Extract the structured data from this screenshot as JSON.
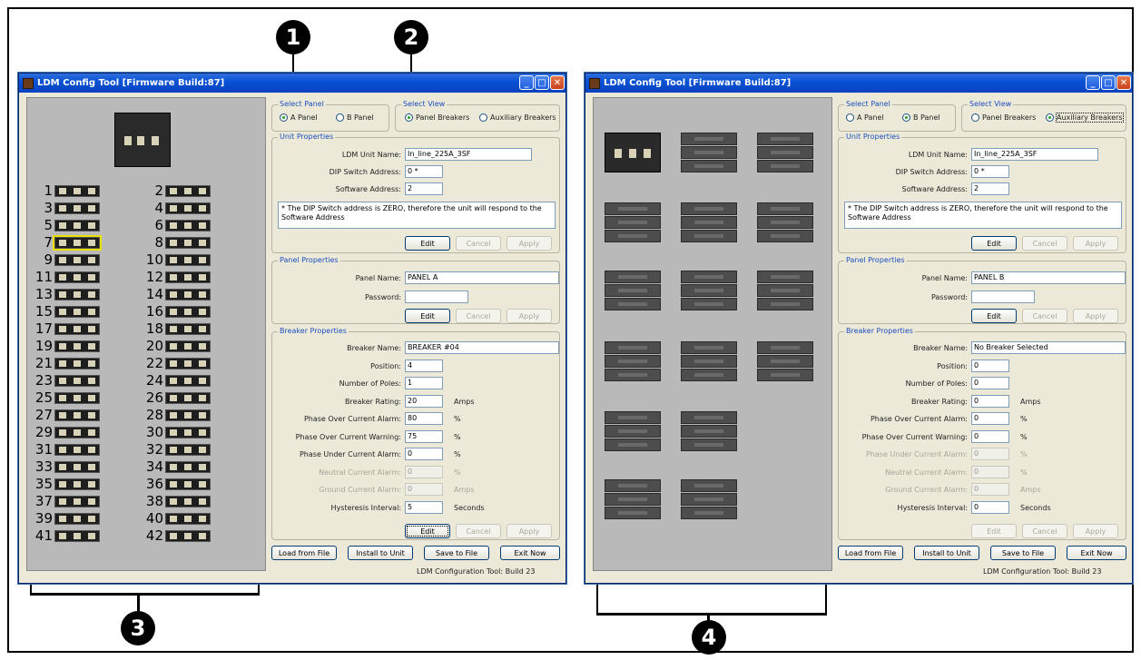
{
  "callouts": [
    "1",
    "2",
    "3",
    "4"
  ],
  "left": {
    "title": "LDM Config Tool [Firmware Build:87]",
    "select_panel": {
      "label": "Select Panel",
      "a": "A Panel",
      "b": "B Panel",
      "selected": "A Panel"
    },
    "select_view": {
      "label": "Select View",
      "panel": "Panel Breakers",
      "aux": "Auxiliary Breakers",
      "selected": "Panel Breakers"
    },
    "unit": {
      "label": "Unit Properties",
      "name_label": "LDM Unit Name:",
      "name": "In_line_225A_3SF",
      "dip_label": "DIP Switch Address:",
      "dip": "0 *",
      "sw_label": "Software Address:",
      "sw": "2",
      "note": "* The DIP Switch address is ZERO, therefore the unit will respond to the Software Address",
      "edit": "Edit",
      "cancel": "Cancel",
      "apply": "Apply"
    },
    "panel": {
      "label": "Panel Properties",
      "name_label": "Panel Name:",
      "name": "PANEL A",
      "pw_label": "Password:",
      "pw": "",
      "edit": "Edit",
      "cancel": "Cancel",
      "apply": "Apply"
    },
    "breaker": {
      "label": "Breaker Properties",
      "name_label": "Breaker Name:",
      "name": "BREAKER #04",
      "pos_label": "Position:",
      "pos": "4",
      "poles_label": "Number of Poles:",
      "poles": "1",
      "rating_label": "Breaker Rating:",
      "rating": "20",
      "rating_unit": "Amps",
      "poca_label": "Phase Over Current Alarm:",
      "poca": "80",
      "poca_unit": "%",
      "pocw_label": "Phase Over Current Warning:",
      "pocw": "75",
      "pocw_unit": "%",
      "puca_label": "Phase Under Current Alarm:",
      "puca": "0",
      "puca_unit": "%",
      "nca_label": "Neutral Current Alarm:",
      "nca": "0",
      "nca_unit": "%",
      "gca_label": "Ground Current Alarm:",
      "gca": "0",
      "gca_unit": "Amps",
      "hyst_label": "Hysteresis Interval:",
      "hyst": "5",
      "hyst_unit": "Seconds",
      "edit": "Edit",
      "cancel": "Cancel",
      "apply": "Apply"
    },
    "bottom": {
      "load": "Load from File",
      "install": "Install to Unit",
      "save": "Save to File",
      "exit": "Exit Now"
    },
    "status": "LDM Configuration Tool: Build 23",
    "breaker_numbers_left": [
      "1",
      "3",
      "5",
      "7",
      "9",
      "11",
      "13",
      "15",
      "17",
      "19",
      "21",
      "23",
      "25",
      "27",
      "29",
      "31",
      "33",
      "35",
      "37",
      "39",
      "41"
    ],
    "breaker_numbers_right": [
      "2",
      "4",
      "6",
      "8",
      "10",
      "12",
      "14",
      "16",
      "18",
      "20",
      "22",
      "24",
      "26",
      "28",
      "30",
      "32",
      "34",
      "36",
      "38",
      "40",
      "42"
    ],
    "selected_breaker": "7"
  },
  "right": {
    "title": "LDM Config Tool [Firmware Build:87]",
    "select_panel": {
      "label": "Select Panel",
      "a": "A Panel",
      "b": "B Panel",
      "selected": "B Panel"
    },
    "select_view": {
      "label": "Select View",
      "panel": "Panel Breakers",
      "aux": "Auxiliary Breakers",
      "selected": "Auxiliary Breakers"
    },
    "unit": {
      "label": "Unit Properties",
      "name_label": "LDM Unit Name:",
      "name": "In_line_225A_3SF",
      "dip_label": "DIP Switch Address:",
      "dip": "0 *",
      "sw_label": "Software Address:",
      "sw": "2",
      "note": "* The DIP Switch address is ZERO, therefore the unit will respond to the Software Address",
      "edit": "Edit",
      "cancel": "Cancel",
      "apply": "Apply"
    },
    "panel": {
      "label": "Panel Properties",
      "name_label": "Panel Name:",
      "name": "PANEL B",
      "pw_label": "Password:",
      "pw": "",
      "edit": "Edit",
      "cancel": "Cancel",
      "apply": "Apply"
    },
    "breaker": {
      "label": "Breaker Properties",
      "name_label": "Breaker Name:",
      "name": "No Breaker Selected",
      "pos_label": "Position:",
      "pos": "0",
      "poles_label": "Number of Poles:",
      "poles": "0",
      "rating_label": "Breaker Rating:",
      "rating": "0",
      "rating_unit": "Amps",
      "poca_label": "Phase Over Current Alarm:",
      "poca": "0",
      "poca_unit": "%",
      "pocw_label": "Phase Over Current Warning:",
      "pocw": "0",
      "pocw_unit": "%",
      "puca_label": "Phase Under Current Alarm:",
      "puca": "0",
      "puca_unit": "%",
      "nca_label": "Neutral Current Alarm:",
      "nca": "0",
      "nca_unit": "%",
      "gca_label": "Ground Current Alarm:",
      "gca": "0",
      "gca_unit": "Amps",
      "hyst_label": "Hysteresis Interval:",
      "hyst": "0",
      "hyst_unit": "Seconds",
      "edit": "Edit",
      "cancel": "Cancel",
      "apply": "Apply"
    },
    "bottom": {
      "load": "Load from File",
      "install": "Install to Unit",
      "save": "Save to File",
      "exit": "Exit Now"
    },
    "status": "LDM Configuration Tool: Build 23"
  }
}
